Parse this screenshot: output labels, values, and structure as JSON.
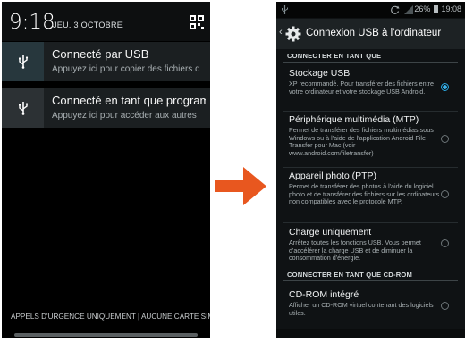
{
  "left_phone": {
    "time": "9:18",
    "date": "JEU. 3 OCTOBRE",
    "notifications": [
      {
        "title": "Connecté par USB",
        "subtitle": "Appuyez ici pour copier des fichiers d",
        "icon": "usb-icon"
      },
      {
        "title": "Connecté en tant que program",
        "subtitle": "Appuyez ici pour accéder aux autres",
        "icon": "usb-icon"
      }
    ],
    "emergency_text": "APPELS D'URGENCE UNIQUEMENT | AUCUNE CARTE SIM"
  },
  "right_phone": {
    "status": {
      "battery": "26%",
      "time": "19:08"
    },
    "title": "Connexion USB à l'ordinateur",
    "section_connect_as": "CONNECTER EN TANT QUE",
    "section_cdrom": "CONNECTER EN TANT QUE CD-ROM",
    "options": [
      {
        "title": "Stockage USB",
        "desc": "XP recommandé. Pour transférer des fichiers entre votre ordinateur et votre stockage USB Android.",
        "selected": true
      },
      {
        "title": "Périphérique multimédia (MTP)",
        "desc": "Permet de transférer des fichiers multimédias sous Windows ou à l'aide de l'application Android File Transfer pour Mac (voir www.android.com/filetransfer)",
        "selected": false
      },
      {
        "title": "Appareil photo (PTP)",
        "desc": "Permet de transférer des photos à l'aide du logiciel photo et de transférer des fichiers sur les ordinateurs non compatibles avec le protocole MTP.",
        "selected": false
      },
      {
        "title": "Charge uniquement",
        "desc": "Arrêtez toutes les fonctions USB. Vous permet d'accélérer la charge USB et de diminuer la consommation d'énergie.",
        "selected": false
      }
    ],
    "cdrom_option": {
      "title": "CD-ROM intégré",
      "desc": "Afficher un CD-ROM virtuel contenant des logiciels utiles.",
      "selected": false
    }
  },
  "colors": {
    "arrow": "#e8571f",
    "radio_selected": "#39b4ee"
  }
}
